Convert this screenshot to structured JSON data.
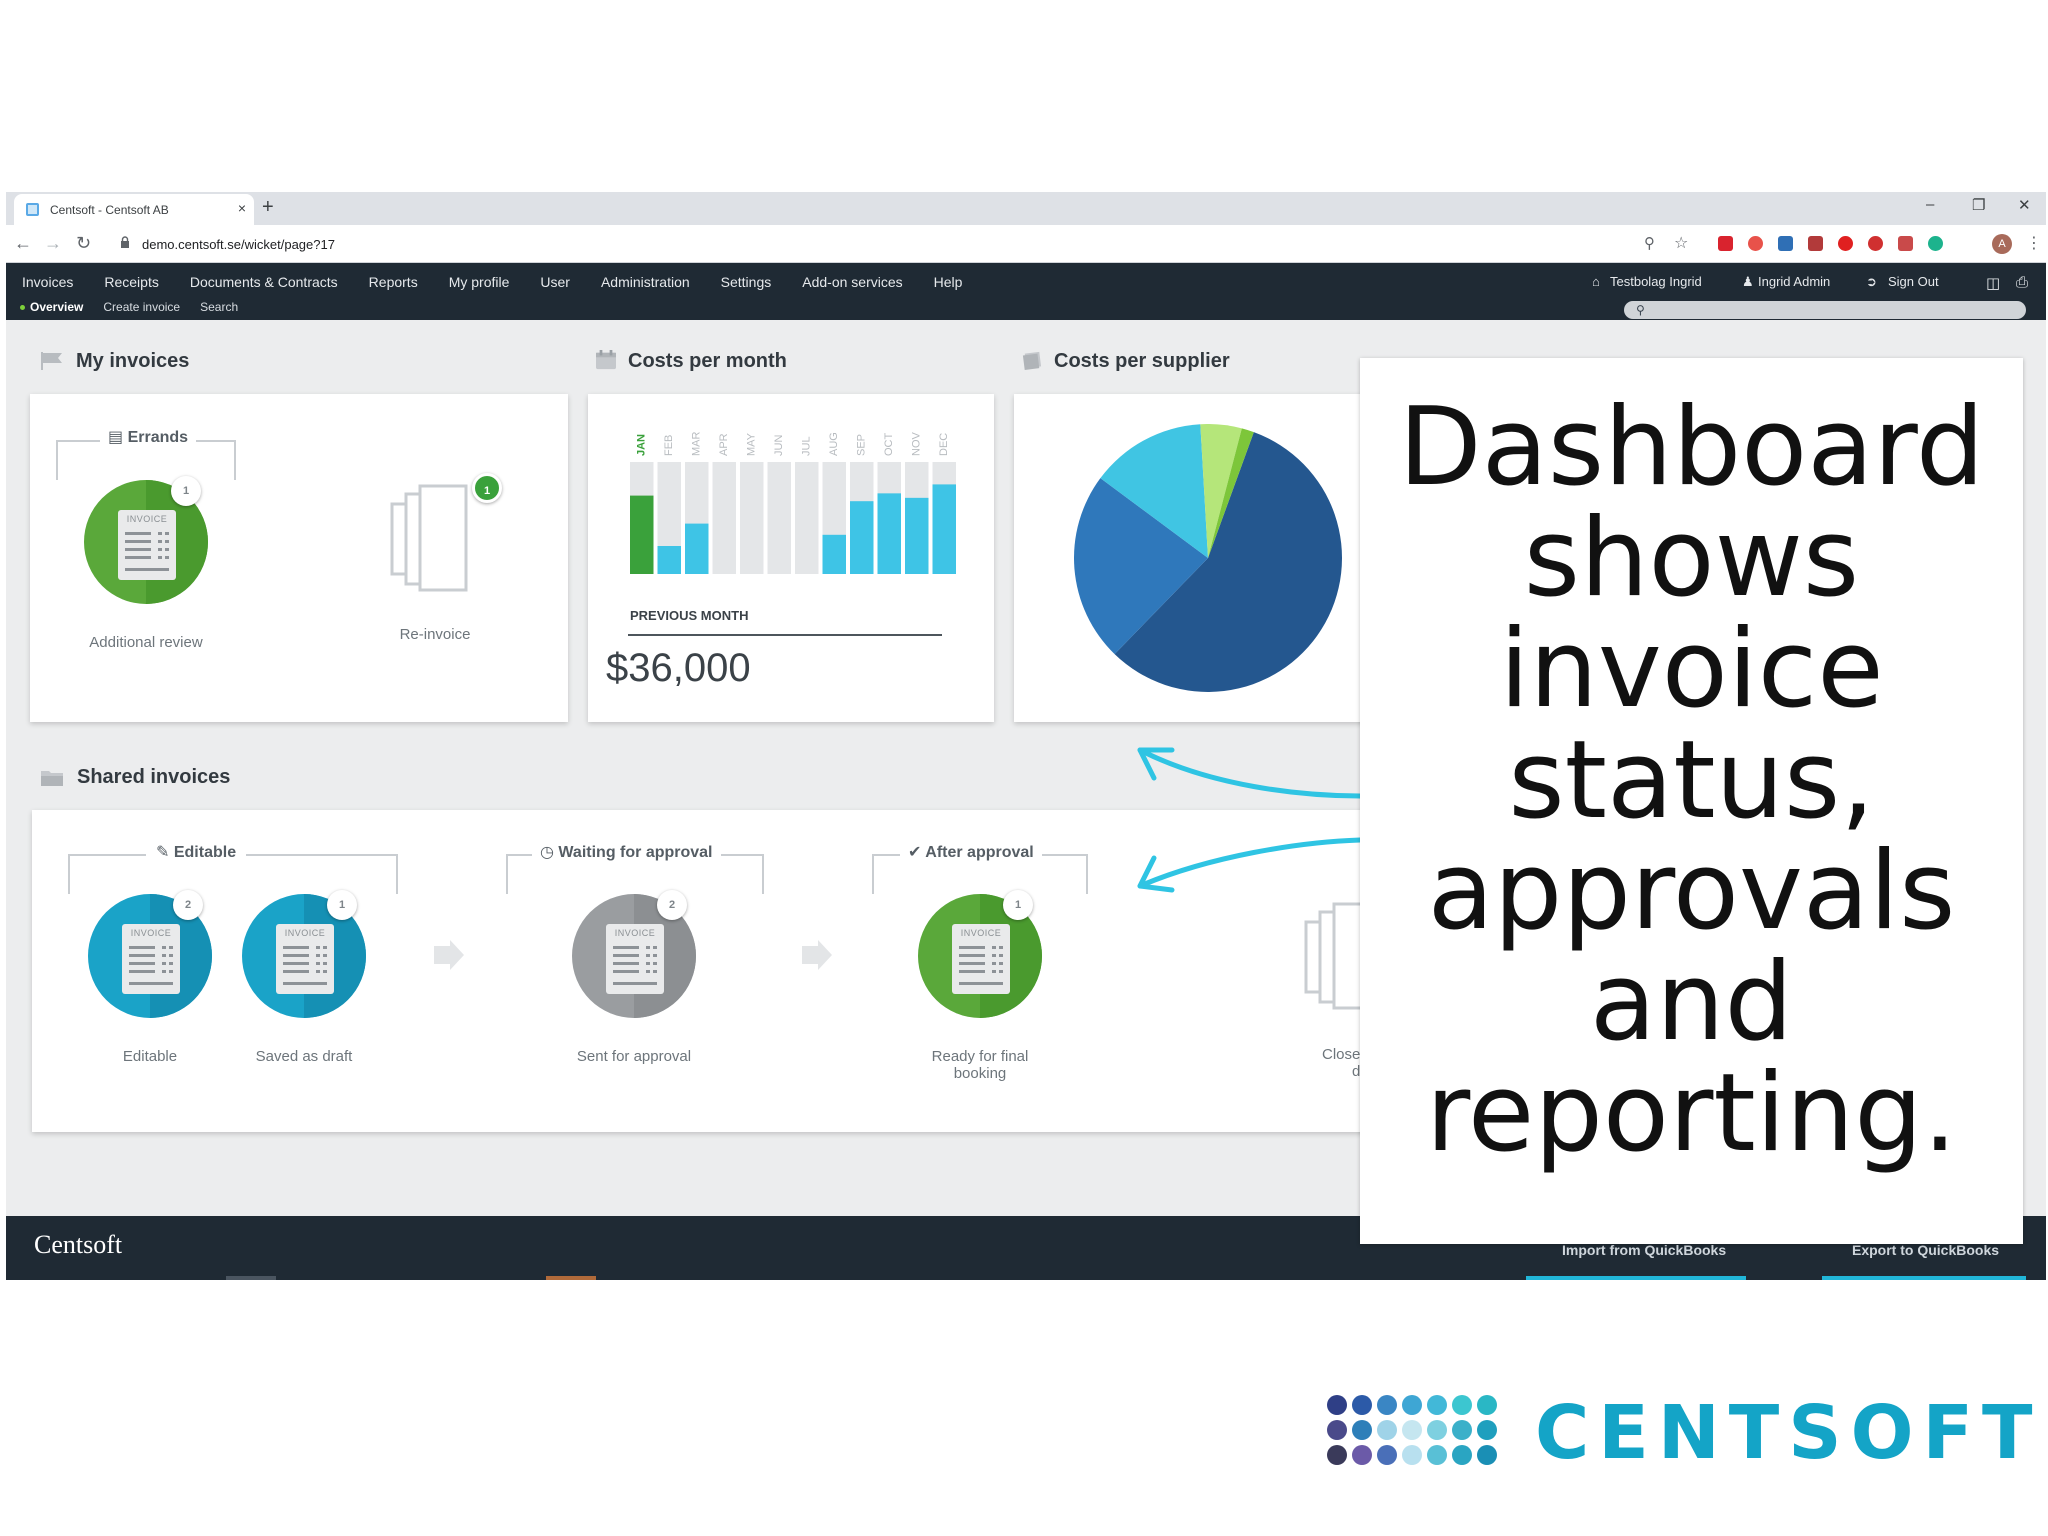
{
  "browser": {
    "tab_title": "Centsoft - Centsoft AB",
    "tab_close": "×",
    "new_tab": "+",
    "url": "demo.centsoft.se/wicket/page?17",
    "win_min": "–",
    "win_restore": "❐",
    "win_close": "✕",
    "profile_initial": "A"
  },
  "nav": {
    "main": [
      "Invoices",
      "Receipts",
      "Documents & Contracts",
      "Reports",
      "My profile",
      "User",
      "Administration",
      "Settings",
      "Add-on services",
      "Help"
    ],
    "sub": [
      "Overview",
      "Create invoice",
      "Search"
    ],
    "company": "Testbolag Ingrid",
    "user": "Ingrid Admin",
    "signout": "Sign Out"
  },
  "my_invoices": {
    "title": "My invoices",
    "group_label": "Errands",
    "items": [
      {
        "label": "Additional review",
        "count": "1"
      },
      {
        "label": "Re-invoice",
        "count": "1"
      }
    ],
    "invoice_word": "INVOICE"
  },
  "costs_per_month": {
    "title": "Costs per month",
    "summary_label": "PREVIOUS MONTH",
    "summary_value": "$36,000"
  },
  "costs_per_supplier": {
    "title": "Costs per supplier"
  },
  "chart_data": [
    {
      "type": "bar",
      "categories": [
        "JAN",
        "FEB",
        "MAR",
        "APR",
        "MAY",
        "JUN",
        "JUL",
        "AUG",
        "SEP",
        "OCT",
        "NOV",
        "DEC"
      ],
      "values": [
        0.7,
        0.25,
        0.45,
        0,
        0,
        0,
        0,
        0.35,
        0.65,
        0.72,
        0.68,
        0.8
      ],
      "highlight_colors": [
        "#3aa13b",
        "#3ec4e6",
        "#3ec4e6",
        "#3ec4e6",
        "#3ec4e6",
        "#3ec4e6",
        "#3ec4e6",
        "#3ec4e6",
        "#3ec4e6",
        "#3ec4e6",
        "#3ec4e6",
        "#3ec4e6"
      ],
      "background_color": "#e4e6e8",
      "ylim": [
        0,
        1
      ]
    },
    {
      "type": "pie",
      "values": [
        57,
        23,
        14,
        5,
        1.5
      ],
      "colors": [
        "#24578f",
        "#2f78bb",
        "#40c5e3",
        "#b5e67a",
        "#7dc63a"
      ]
    }
  ],
  "shared_invoices": {
    "title": "Shared invoices",
    "groups": [
      {
        "label": "Editable",
        "items": [
          {
            "label": "Editable",
            "count": "2",
            "color": "#1aa3c8"
          },
          {
            "label": "Saved as draft",
            "count": "1",
            "color": "#1aa3c8"
          }
        ]
      },
      {
        "label": "Waiting for approval",
        "items": [
          {
            "label": "Sent for approval",
            "count": "2",
            "color": "#9a9da0"
          }
        ]
      },
      {
        "label": "After approval",
        "items": [
          {
            "label": "Ready for final booking",
            "count": "1",
            "color": "#5aa83a"
          }
        ]
      }
    ],
    "closed_label_partial": "Close",
    "closed_label_partial2": "d"
  },
  "footer": {
    "brand": "Centsoft",
    "import_btn": "Import from QuickBooks",
    "export_btn": "Export to QuickBooks"
  },
  "callout": {
    "lines": [
      "Dashboard",
      "shows",
      "invoice",
      "status,",
      "approvals",
      "and",
      "reporting."
    ]
  },
  "logo": {
    "wordmark": "CENTSOFT",
    "dot_colors": [
      "#2f3f86",
      "#2c5aa8",
      "#3a86c4",
      "#3ea6d4",
      "#42b8d8",
      "#3cc6d0",
      "#2ab7c5",
      "#4a4a8a",
      "#2e7fb9",
      "#9fd3e8",
      "#c5e6f0",
      "#7ed0e0",
      "#3bb0c9",
      "#1f9fbe",
      "#3a3a5a",
      "#6b5aa8",
      "#4a6fb8",
      "#b8e0ef",
      "#59c0d6",
      "#2aa5c2",
      "#1a8fb5"
    ]
  }
}
